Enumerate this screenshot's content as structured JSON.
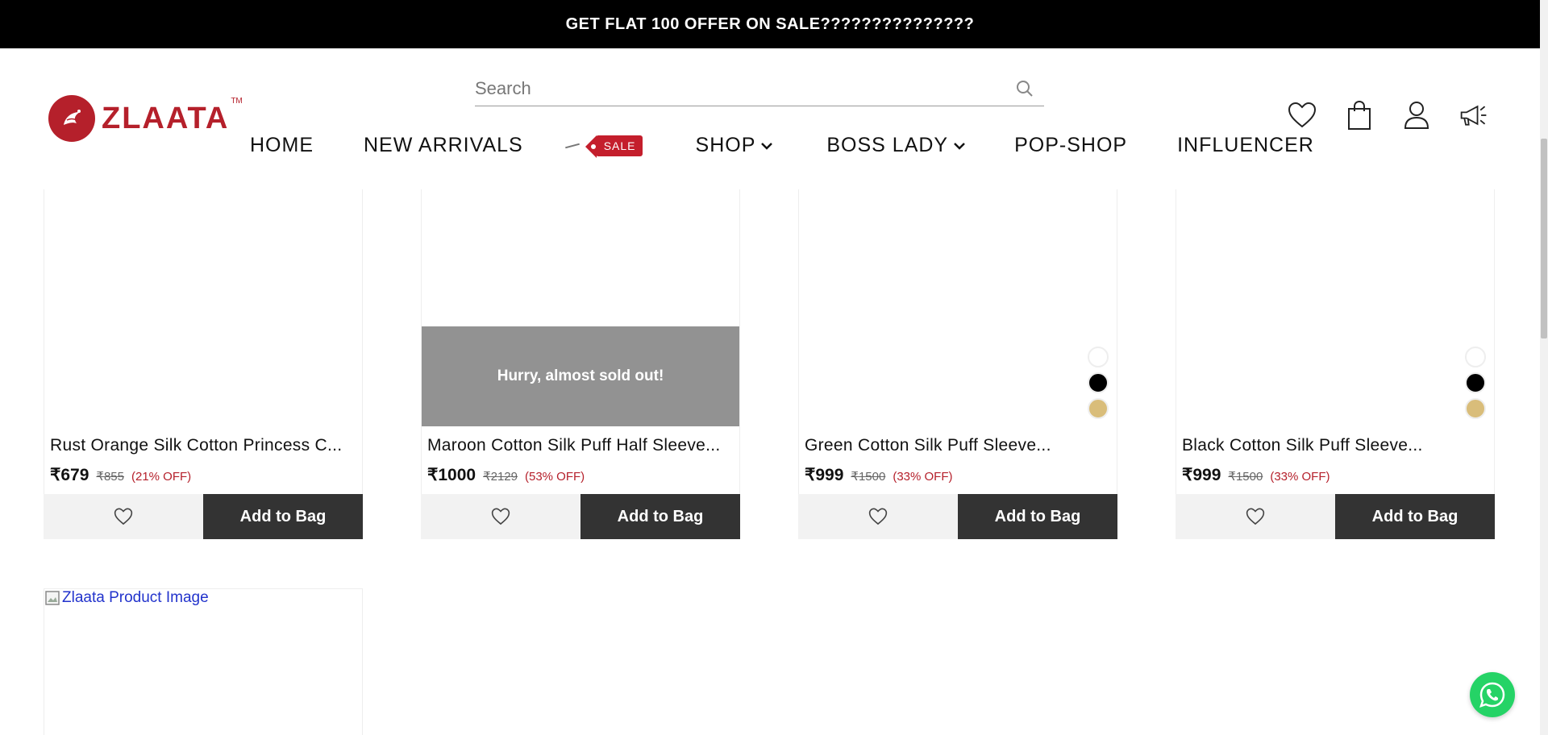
{
  "announcement": {
    "text": "GET FLAT 100 OFFER ON SALE???????????????"
  },
  "brand": {
    "name": "ZLAATA",
    "tm": "TM"
  },
  "search": {
    "placeholder": "Search"
  },
  "nav": {
    "home": "HOME",
    "new_arrivals": "NEW ARRIVALS",
    "sale": "SALE",
    "shop": "SHOP",
    "boss_lady": "BOSS LADY",
    "pop_shop": "POP-SHOP",
    "influencer": "INFLUENCER"
  },
  "header_icons": [
    "heart-icon",
    "shopping-bag-icon",
    "user-icon",
    "megaphone-icon"
  ],
  "products": [
    {
      "title": "Rust Orange Silk Cotton Princess C...",
      "price": "₹679",
      "mrp": "₹855",
      "discount": "(21% OFF)",
      "add_label": "Add to Bag",
      "overlay": "",
      "swatches": []
    },
    {
      "title": "Maroon Cotton Silk Puff Half Sleeve...",
      "price": "₹1000",
      "mrp": "₹2129",
      "discount": "(53% OFF)",
      "add_label": "Add to Bag",
      "overlay": "Hurry, almost sold out!",
      "swatches": []
    },
    {
      "title": "Green Cotton Silk Puff Sleeve...",
      "price": "₹999",
      "mrp": "₹1500",
      "discount": "(33% OFF)",
      "add_label": "Add to Bag",
      "overlay": "",
      "swatches": [
        "#ffffff",
        "#000000",
        "#d9bd7a"
      ]
    },
    {
      "title": "Black Cotton Silk Puff Sleeve...",
      "price": "₹999",
      "mrp": "₹1500",
      "discount": "(33% OFF)",
      "add_label": "Add to Bag",
      "overlay": "",
      "swatches": [
        "#ffffff",
        "#000000",
        "#d9bd7a"
      ]
    }
  ],
  "broken_image": {
    "alt": "Zlaata Product Image"
  },
  "colors": {
    "brand": "#b5202b",
    "sale_tag": "#c41e2c",
    "add_button": "#333333",
    "whatsapp": "#25d366"
  }
}
